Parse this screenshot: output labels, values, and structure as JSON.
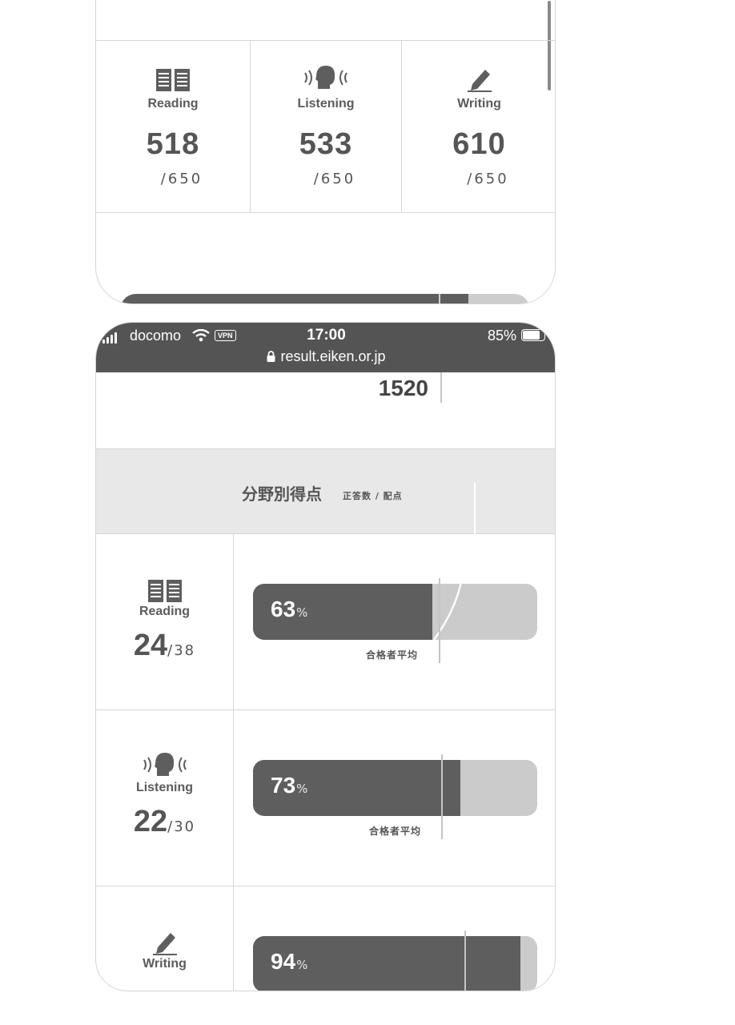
{
  "summary": {
    "skills": [
      {
        "label": "Reading",
        "icon": "book-icon",
        "score": "518",
        "max": "/650"
      },
      {
        "label": "Listening",
        "icon": "listening-head-icon",
        "score": "533",
        "max": "/650"
      },
      {
        "label": "Writing",
        "icon": "pencil-icon",
        "score": "610",
        "max": "/650"
      }
    ],
    "total_bar_fill": 0.85
  },
  "status_bar": {
    "carrier": "docomo",
    "vpn": "VPN",
    "time": "17:00",
    "battery": "85%",
    "url": "result.eiken.or.jp"
  },
  "total_score": "1520",
  "section": {
    "title": "分野別得点",
    "subtitle": "正答数 / 配点"
  },
  "average_label": "合格者平均",
  "details": [
    {
      "label": "Reading",
      "icon": "book-icon",
      "correct": "24",
      "max": "/38",
      "percent": "63",
      "unit": "%"
    },
    {
      "label": "Listening",
      "icon": "listening-head-icon",
      "correct": "22",
      "max": "/30",
      "percent": "73",
      "unit": "%"
    },
    {
      "label": "Writing",
      "icon": "pencil-icon",
      "correct": "",
      "max": "",
      "percent": "94",
      "unit": "%"
    }
  ]
}
